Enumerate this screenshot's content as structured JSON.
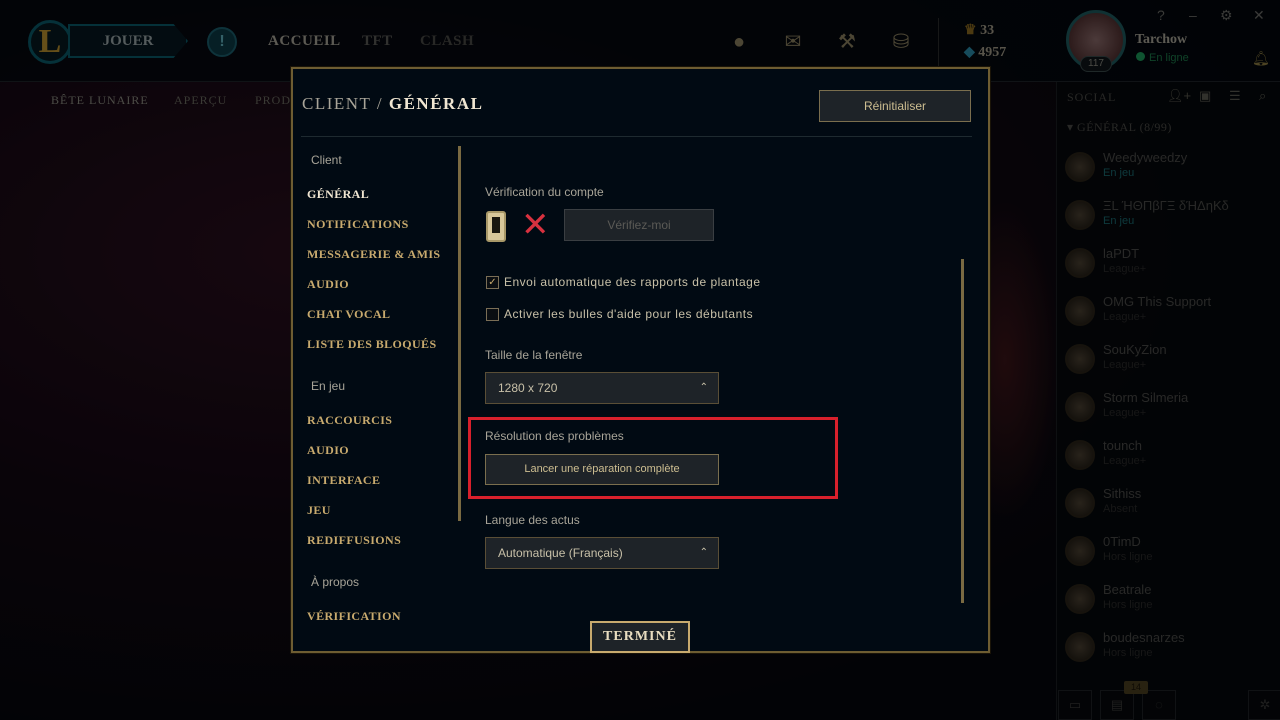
{
  "topbar": {
    "logo": "L",
    "play": "JOUER",
    "nav": [
      "ACCUEIL",
      "TFT",
      "CLASH"
    ],
    "tokens": "33",
    "blue_essence": "4957",
    "username": "Tarchow",
    "status": "En ligne",
    "level": "117",
    "window_controls": [
      "?",
      "–",
      "⚙",
      "✕"
    ]
  },
  "subnav": [
    "BÊTE LUNAIRE",
    "APERÇU",
    "PROD"
  ],
  "social": {
    "title": "SOCIAL",
    "group": "▾ GÉNÉRAL (8/99)",
    "friends": [
      {
        "name": "Weedyweedzy",
        "status": "En jeu",
        "ingame": true
      },
      {
        "name": "ΞL ΉΘΠβΓΞ δΉΔηΚδ",
        "status": "En jeu",
        "ingame": true
      },
      {
        "name": "laPDT",
        "status": "League+"
      },
      {
        "name": "OMG This Support",
        "status": "League+"
      },
      {
        "name": "SouKyZion",
        "status": "League+"
      },
      {
        "name": "Storm Silmeria",
        "status": "League+"
      },
      {
        "name": "tounch",
        "status": "League+"
      },
      {
        "name": "Sithiss",
        "status": "Absent"
      },
      {
        "name": "0TimD",
        "status": "Hors ligne"
      },
      {
        "name": "Beatrale",
        "status": "Hors ligne"
      },
      {
        "name": "boudesnarzes",
        "status": "Hors ligne"
      }
    ],
    "badge": "14"
  },
  "modal": {
    "title_prefix": "CLIENT /",
    "title": "GÉNÉRAL",
    "reset": "Réinitialiser",
    "sidebar": {
      "client_section": "Client",
      "client_items": [
        "GÉNÉRAL",
        "NOTIFICATIONS",
        "MESSAGERIE & AMIS",
        "AUDIO",
        "CHAT VOCAL",
        "LISTE DES BLOQUÉS"
      ],
      "game_section": "En jeu",
      "game_items": [
        "RACCOURCIS",
        "AUDIO",
        "INTERFACE",
        "JEU",
        "REDIFFUSIONS"
      ],
      "about_section": "À propos",
      "about_items": [
        "VÉRIFICATION"
      ]
    },
    "account_label": "Vérification du compte",
    "verify_button": "Vérifiez-moi",
    "crash_reports": {
      "label": "Envoi automatique des rapports de plantage",
      "checked": true
    },
    "tooltips": {
      "label": "Activer les bulles d'aide pour les débutants",
      "checked": false
    },
    "window_size_label": "Taille de la fenêtre",
    "window_size": "1280 x 720",
    "troubleshoot_label": "Résolution des problèmes",
    "repair_button": "Lancer une réparation complète",
    "news_lang_label": "Langue des actus",
    "news_lang": "Automatique (Français)",
    "done": "TERMINÉ"
  },
  "colors": {
    "gold": "#c8aa6e",
    "highlight": "#d8202c",
    "error": "#d8313f"
  }
}
